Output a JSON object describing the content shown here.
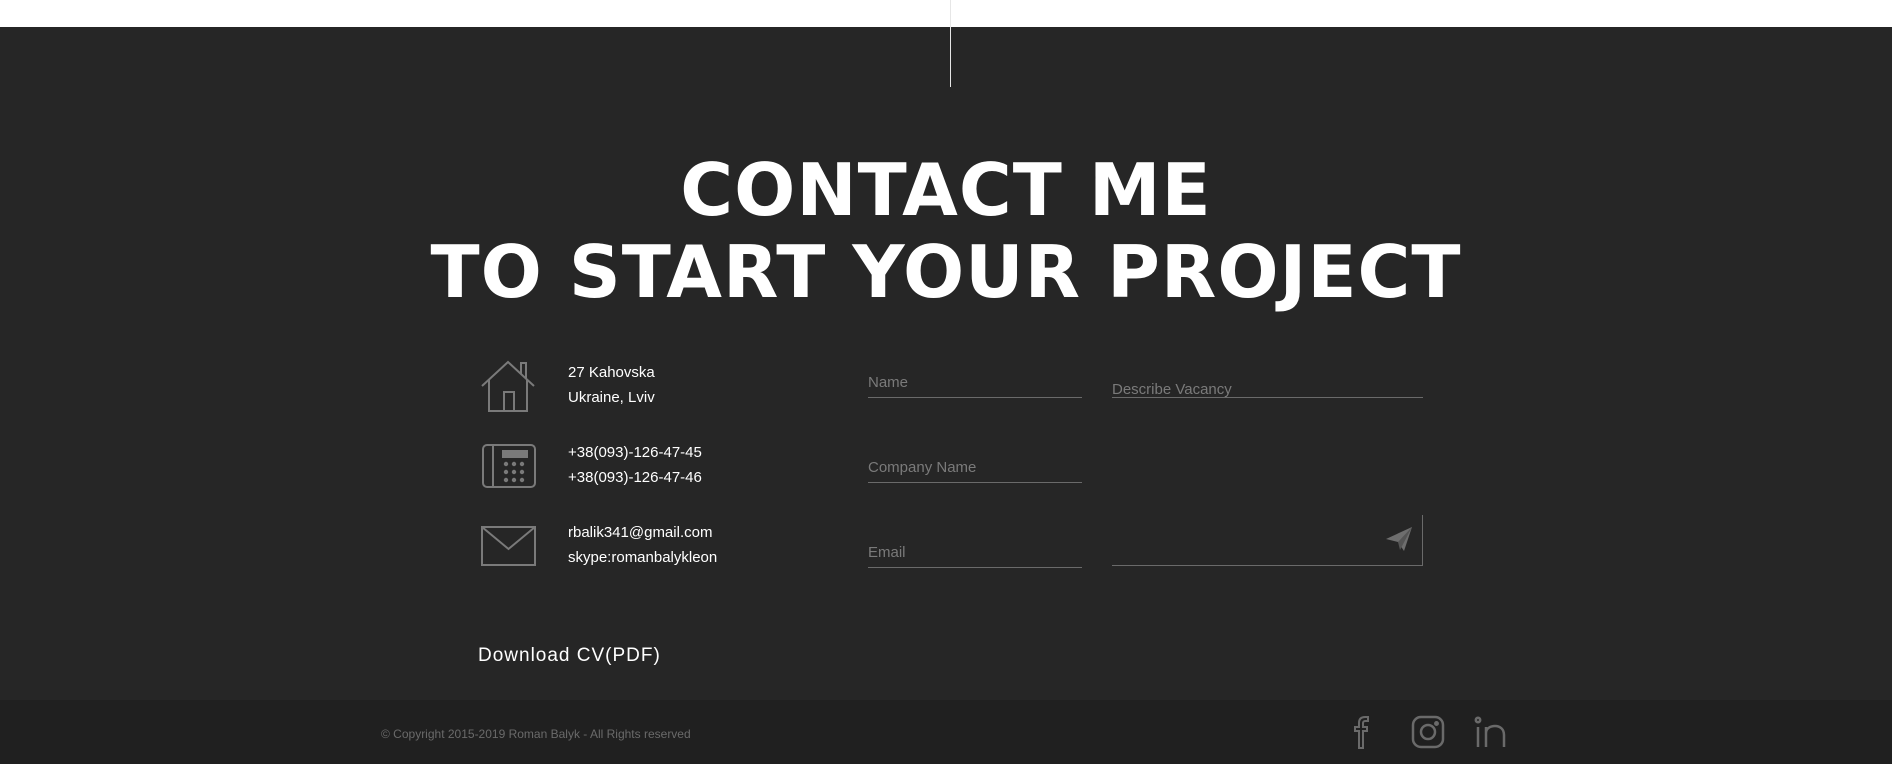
{
  "contact": {
    "title_line1": "CONTACT ME",
    "title_line2": "TO START YOUR PROJECT",
    "address": {
      "icon": "house-icon",
      "line1": "27 Kahovska",
      "line2": "Ukraine, Lviv"
    },
    "phones": {
      "icon": "phone-icon",
      "line1": "+38(093)-126-47-45",
      "line2": "+38(093)-126-47-46"
    },
    "mail": {
      "icon": "envelope-icon",
      "line1": "rbalik341@gmail.com",
      "line2": "skype:romanbalykleon"
    },
    "download_cv": "Download CV(PDF)"
  },
  "form": {
    "name_placeholder": "Name",
    "company_placeholder": "Company Name",
    "email_placeholder": "Email",
    "vacancy_placeholder": "Describe Vacancy",
    "send_icon": "paper-plane-icon"
  },
  "footer": {
    "copyright": "© Copyright 2015-2019 Roman Balyk - All Rights reserved",
    "social": [
      "facebook-icon",
      "instagram-icon",
      "linkedin-icon"
    ]
  },
  "colors": {
    "section_bg": "#262626",
    "footer_bg": "#202020",
    "text": "#ffffff",
    "muted": "#7a7a7a"
  }
}
